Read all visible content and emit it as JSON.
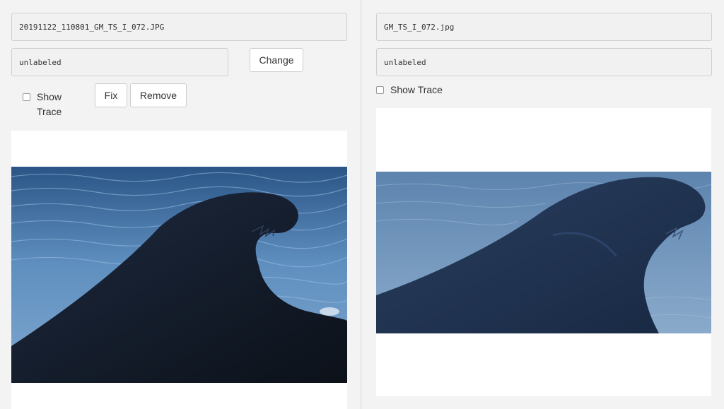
{
  "left": {
    "filename": "20191122_110801_GM_TS_I_072.JPG",
    "label_value": "unlabeled",
    "change_label": "Change",
    "fix_label": "Fix",
    "remove_label": "Remove",
    "show_trace_line1": "Show",
    "show_trace_line2": "Trace"
  },
  "right": {
    "filename": "GM_TS_I_072.jpg",
    "label_value": "unlabeled",
    "show_trace_label": "Show Trace"
  },
  "colors": {
    "water_light": "#5f8fbf",
    "water_dark": "#2c5786",
    "fin_dark": "#141c2b",
    "fin_right": "#1d2f4b"
  }
}
